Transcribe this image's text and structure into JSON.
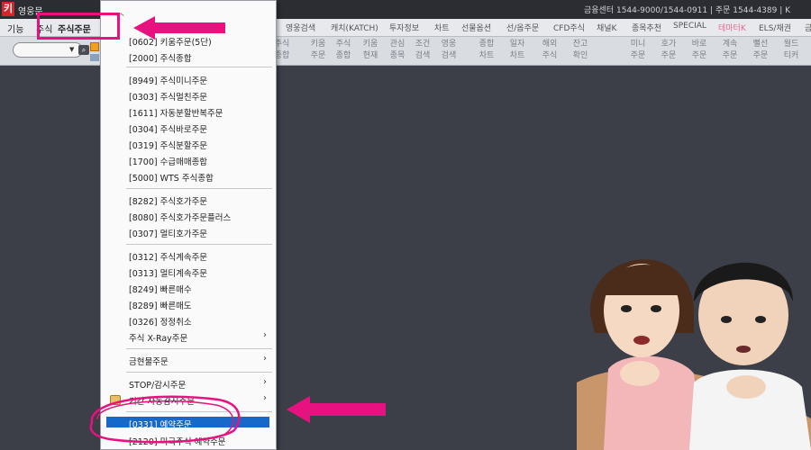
{
  "window": {
    "title": "영웅문",
    "logo_glyph": "키",
    "center_info": "금융센터 1544-9000/1544-0911 | 주문 1544-4389 | K"
  },
  "menubar": {
    "items": [
      "기능",
      "주식",
      "주식주문"
    ],
    "right_items": [
      "영웅검색",
      "캐치(KATCH)",
      "투자정보",
      "차트",
      "선물옵션",
      "선/옵주문",
      "CFD주식",
      "채널K",
      "종목추천",
      "SPECIAL",
      "테마터K",
      "ELS/채권",
      "금"
    ]
  },
  "toolbar": {
    "buttons": [
      {
        "line1": "주식",
        "line2": "종합"
      },
      {
        "line1": "키움",
        "line2": "주문"
      },
      {
        "line1": "주식",
        "line2": "종합"
      },
      {
        "line1": "키움",
        "line2": "현재"
      },
      {
        "line1": "관심",
        "line2": "종목"
      },
      {
        "line1": "조건",
        "line2": "검색"
      },
      {
        "line1": "영웅",
        "line2": "검색"
      },
      {
        "line1": "종합",
        "line2": "차트"
      },
      {
        "line1": "일자",
        "line2": "차트"
      },
      {
        "line1": "해외",
        "line2": "주식"
      },
      {
        "line1": "잔고",
        "line2": "확인"
      },
      {
        "line1": "미니",
        "line2": "주문"
      },
      {
        "line1": "호가",
        "line2": "주문"
      },
      {
        "line1": "바로",
        "line2": "주문"
      },
      {
        "line1": "계속",
        "line2": "주문"
      },
      {
        "line1": "뻘선",
        "line2": "주문"
      },
      {
        "line1": "월드",
        "line2": "티커"
      }
    ],
    "search_dropdown_icon": "chevron-down-icon",
    "search_icon": "search-icon"
  },
  "dropdown": {
    "items": [
      {
        "label": "[0602] 키움주문(5단)",
        "arrow": ""
      },
      {
        "label": "[2000] 주식종합",
        "arrow": ""
      },
      {
        "label": "[8949] 주식미니주문",
        "arrow": ""
      },
      {
        "label": "[0303] 주식멀친주문",
        "arrow": ""
      },
      {
        "label": "[1611] 자동분할반복주문",
        "arrow": ""
      },
      {
        "label": "[0304] 주식바로주문",
        "arrow": ""
      },
      {
        "label": "[0319] 주식분할주문",
        "arrow": ""
      },
      {
        "label": "[1700] 수급매매종합",
        "arrow": ""
      },
      {
        "label": "[5000] WTS 주식종합",
        "arrow": ""
      },
      {
        "label": "[8282] 주식호가주문",
        "arrow": ""
      },
      {
        "label": "[8080] 주식호가주문플러스",
        "arrow": ""
      },
      {
        "label": "[0307] 멀티호가주문",
        "arrow": ""
      },
      {
        "label": "[0312] 주식계속주문",
        "arrow": ""
      },
      {
        "label": "[0313] 멀티계속주문",
        "arrow": ""
      },
      {
        "label": "[8249] 빠른매수",
        "arrow": ""
      },
      {
        "label": "[8289] 빠른매도",
        "arrow": ""
      },
      {
        "label": "[0326] 정정취소",
        "arrow": ""
      },
      {
        "label": "주식 X-Ray주문",
        "arrow": "›"
      },
      {
        "label": "금현물주문",
        "arrow": "›"
      },
      {
        "label": "STOP/감시주문",
        "arrow": "›"
      },
      {
        "label": "기간 자동감시주문",
        "arrow": "›"
      },
      {
        "label": "[0331] 예약주문",
        "arrow": ""
      },
      {
        "label": "[2120] 미국주식 예약주문",
        "arrow": ""
      }
    ],
    "selected_index": 21,
    "highlight_color": "#1769c9"
  },
  "annotations": {
    "color": "#e7127f"
  }
}
